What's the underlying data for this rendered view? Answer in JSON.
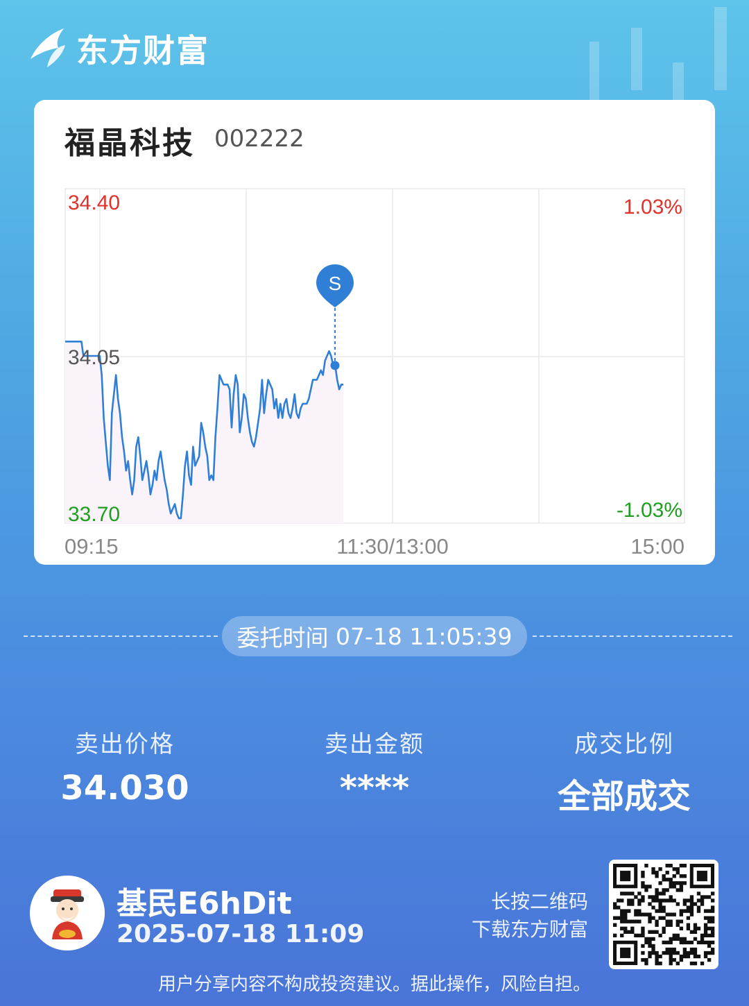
{
  "app": {
    "brand": "东方财富"
  },
  "stock": {
    "name": "福晶科技",
    "code": "002222"
  },
  "chart_data": {
    "type": "line",
    "x_ticks": [
      "09:15",
      "11:30/13:00",
      "15:00"
    ],
    "y_high": "34.40",
    "y_mid": "34.05",
    "y_low": "33.70",
    "pct_high": "1.03%",
    "pct_low": "-1.03%",
    "ylim": [
      33.7,
      34.4
    ],
    "colors": {
      "line": "#2f7fd6",
      "up": "#e0312b",
      "down": "#1f9e1f"
    },
    "marker": {
      "label": "S",
      "price": 34.03
    },
    "series": [
      {
        "values": [
          34.08,
          34.08,
          34.08,
          34.08,
          34.08,
          34.08,
          34.08,
          34.08,
          34.08,
          34.05,
          34.05,
          34.05,
          34.05,
          34.05,
          34.05,
          34.05,
          34.05,
          34.05,
          34.01,
          33.92,
          33.87,
          33.82,
          33.79,
          33.93,
          33.97,
          34.01,
          33.96,
          33.93,
          33.88,
          33.85,
          33.81,
          33.83,
          33.79,
          33.76,
          33.79,
          33.86,
          33.88,
          33.84,
          33.79,
          33.81,
          33.83,
          33.8,
          33.76,
          33.78,
          33.81,
          33.79,
          33.83,
          33.85,
          33.82,
          33.79,
          33.77,
          33.74,
          33.72,
          33.73,
          33.74,
          33.72,
          33.71,
          33.71,
          33.76,
          33.82,
          33.85,
          33.8,
          33.78,
          33.86,
          33.82,
          33.83,
          33.84,
          33.91,
          33.89,
          33.86,
          33.84,
          33.79,
          33.8,
          33.79,
          33.88,
          33.94,
          34.01,
          34.0,
          33.99,
          33.99,
          33.99,
          33.98,
          33.9,
          33.97,
          34.01,
          33.99,
          33.89,
          33.92,
          33.97,
          33.96,
          33.92,
          33.89,
          33.87,
          33.86,
          33.88,
          33.91,
          33.94,
          34.0,
          33.93,
          33.97,
          34.0,
          33.99,
          33.98,
          33.94,
          33.96,
          33.92,
          33.95,
          33.92,
          33.95,
          33.96,
          33.93,
          33.92,
          33.94,
          33.97,
          33.93,
          33.92,
          33.94,
          33.95,
          33.95,
          33.95,
          33.96,
          33.98,
          34.0,
          34.0,
          34.0,
          34.01,
          34.02,
          34.01,
          34.04,
          34.05,
          34.06,
          34.05,
          34.03,
          34.03,
          34.0,
          33.98,
          33.99,
          33.99
        ]
      }
    ]
  },
  "entrust": {
    "label": "委托时间",
    "time": "07-18 11:05:39"
  },
  "stats": [
    {
      "label": "卖出价格",
      "value": "34.030"
    },
    {
      "label": "卖出金额",
      "value": "****"
    },
    {
      "label": "成交比例",
      "value": "全部成交"
    }
  ],
  "user": {
    "name": "基民E6hDit",
    "time": "2025-07-18 11:09"
  },
  "qr": {
    "line1": "长按二维码",
    "line2": "下载东方财富"
  },
  "disclaimer": "用户分享内容不构成投资建议。据此操作，风险自担。"
}
